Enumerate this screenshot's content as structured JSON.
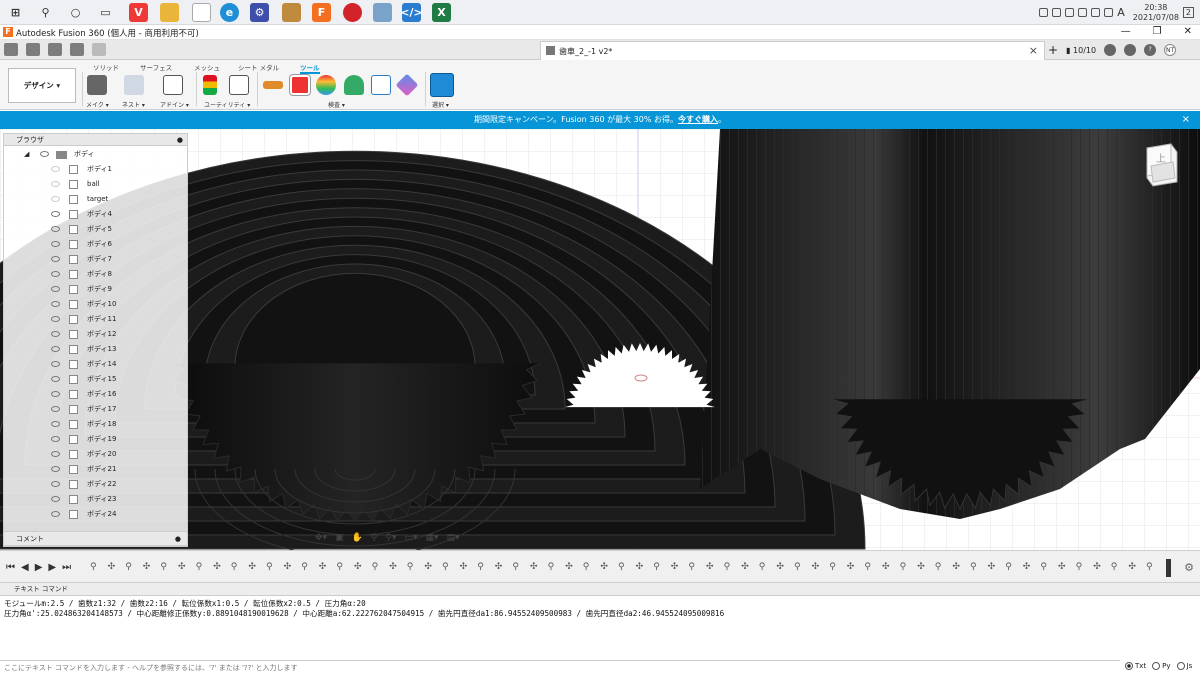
{
  "taskbar": {
    "icons": [
      "windows-logo-icon",
      "search-icon",
      "cortana-icon",
      "task-view-icon",
      "vivaldi-icon",
      "folder-icon",
      "file-icon",
      "edge-icon",
      "settings-icon",
      "archive-icon",
      "fusion-icon",
      "app-red-icon",
      "app-tool-icon",
      "vscode-icon",
      "excel-icon"
    ],
    "ime": "A",
    "time": "20:38",
    "date": "2021/07/08",
    "notifications": "2"
  },
  "window": {
    "title": "Autodesk Fusion 360 (個人用 - 商用利用不可)"
  },
  "document": {
    "tab_title": "歯車_2_-1 v2*",
    "close": "×",
    "job_count": "10/10",
    "user_initials": "NT"
  },
  "ribbon": {
    "tabs": [
      "ソリッド",
      "サーフェス",
      "メッシュ",
      "シート メタル",
      "ツール"
    ],
    "active_tab": "ツール",
    "workspace": "デザイン ▾",
    "groups": [
      "メイク ▾",
      "ネスト ▾",
      "アドイン ▾",
      "ユーティリティ ▾",
      "検査 ▾",
      "選択 ▾"
    ]
  },
  "banner": {
    "text": "期間限定キャンペーン。Fusion 360 が最大 30% お得。",
    "link": "今すぐ購入",
    "suffix": "。",
    "close": "×"
  },
  "browser": {
    "title": "ブラウザ",
    "root": "ボディ",
    "items": [
      {
        "label": "ボディ1",
        "visible": false
      },
      {
        "label": "ball",
        "visible": false
      },
      {
        "label": "target",
        "visible": false
      },
      {
        "label": "ボディ4",
        "visible": true
      },
      {
        "label": "ボディ5",
        "visible": true
      },
      {
        "label": "ボディ6",
        "visible": true
      },
      {
        "label": "ボディ7",
        "visible": true
      },
      {
        "label": "ボディ8",
        "visible": true
      },
      {
        "label": "ボディ9",
        "visible": true
      },
      {
        "label": "ボディ10",
        "visible": true
      },
      {
        "label": "ボディ11",
        "visible": true
      },
      {
        "label": "ボディ12",
        "visible": true
      },
      {
        "label": "ボディ13",
        "visible": true
      },
      {
        "label": "ボディ14",
        "visible": true
      },
      {
        "label": "ボディ15",
        "visible": true
      },
      {
        "label": "ボディ16",
        "visible": true
      },
      {
        "label": "ボディ17",
        "visible": true
      },
      {
        "label": "ボディ18",
        "visible": true
      },
      {
        "label": "ボディ19",
        "visible": true
      },
      {
        "label": "ボディ20",
        "visible": true
      },
      {
        "label": "ボディ21",
        "visible": true
      },
      {
        "label": "ボディ22",
        "visible": true
      },
      {
        "label": "ボディ23",
        "visible": true
      },
      {
        "label": "ボディ24",
        "visible": true
      }
    ],
    "comments": "コメント"
  },
  "viewcube": {
    "face": "上"
  },
  "textcommand": {
    "title": "テキスト コマンド",
    "line1": "モジュールm:2.5 / 歯数z1:32 / 歯数z2:16 / 転位係数x1:0.5 / 転位係数x2:0.5 / 圧力角α:20",
    "line2": "圧力角α':25.024863204148573 / 中心距離修正係数y:0.8891048190019628 / 中心距離a:62.222762047504915 / 歯先円直径da1:86.94552409500983 / 歯先円直径da2:46.945524095009816",
    "placeholder": "ここにテキスト コマンドを入力します - ヘルプを参照するには、'?' または '??' と入力します",
    "modes": [
      "Txt",
      "Py",
      "Js"
    ],
    "selected_mode": "Txt"
  },
  "colors": {
    "accent": "#0696d7",
    "brand": "#f37021",
    "gear": "#151515"
  }
}
